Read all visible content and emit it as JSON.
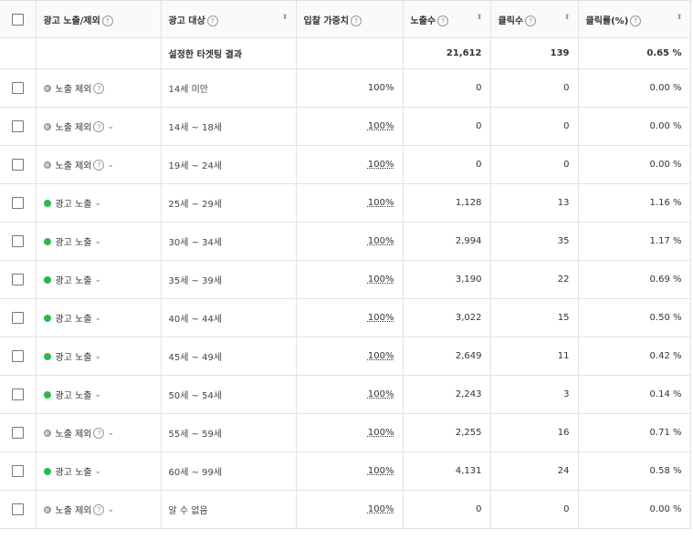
{
  "headers": {
    "status": "광고 노출/제외",
    "target": "광고 대상",
    "bid": "입찰 가중치",
    "impressions": "노출수",
    "clicks": "클릭수",
    "ctr": "클릭률(%)"
  },
  "summary": {
    "label": "설정한 타겟팅 결과",
    "impressions": "21,612",
    "clicks": "139",
    "ctr": "0.65 %"
  },
  "rows": [
    {
      "status": "노출 제외",
      "active": false,
      "help": true,
      "chevron": false,
      "target": "14세 미만",
      "bid": "100%",
      "bid_link": false,
      "impressions": "0",
      "clicks": "0",
      "ctr": "0.00 %"
    },
    {
      "status": "노출 제외",
      "active": false,
      "help": true,
      "chevron": true,
      "target": "14세 ~ 18세",
      "bid": "100%",
      "bid_link": true,
      "impressions": "0",
      "clicks": "0",
      "ctr": "0.00 %"
    },
    {
      "status": "노출 제외",
      "active": false,
      "help": true,
      "chevron": true,
      "target": "19세 ~ 24세",
      "bid": "100%",
      "bid_link": true,
      "impressions": "0",
      "clicks": "0",
      "ctr": "0.00 %"
    },
    {
      "status": "광고 노출",
      "active": true,
      "help": false,
      "chevron": true,
      "target": "25세 ~ 29세",
      "bid": "100%",
      "bid_link": true,
      "impressions": "1,128",
      "clicks": "13",
      "ctr": "1.16 %"
    },
    {
      "status": "광고 노출",
      "active": true,
      "help": false,
      "chevron": true,
      "target": "30세 ~ 34세",
      "bid": "100%",
      "bid_link": true,
      "impressions": "2,994",
      "clicks": "35",
      "ctr": "1.17 %"
    },
    {
      "status": "광고 노출",
      "active": true,
      "help": false,
      "chevron": true,
      "target": "35세 ~ 39세",
      "bid": "100%",
      "bid_link": true,
      "impressions": "3,190",
      "clicks": "22",
      "ctr": "0.69 %"
    },
    {
      "status": "광고 노출",
      "active": true,
      "help": false,
      "chevron": true,
      "target": "40세 ~ 44세",
      "bid": "100%",
      "bid_link": true,
      "impressions": "3,022",
      "clicks": "15",
      "ctr": "0.50 %"
    },
    {
      "status": "광고 노출",
      "active": true,
      "help": false,
      "chevron": true,
      "target": "45세 ~ 49세",
      "bid": "100%",
      "bid_link": true,
      "impressions": "2,649",
      "clicks": "11",
      "ctr": "0.42 %"
    },
    {
      "status": "광고 노출",
      "active": true,
      "help": false,
      "chevron": true,
      "target": "50세 ~ 54세",
      "bid": "100%",
      "bid_link": true,
      "impressions": "2,243",
      "clicks": "3",
      "ctr": "0.14 %"
    },
    {
      "status": "노출 제외",
      "active": false,
      "help": true,
      "chevron": true,
      "target": "55세 ~ 59세",
      "bid": "100%",
      "bid_link": true,
      "impressions": "2,255",
      "clicks": "16",
      "ctr": "0.71 %"
    },
    {
      "status": "광고 노출",
      "active": true,
      "help": false,
      "chevron": true,
      "target": "60세 ~ 99세",
      "bid": "100%",
      "bid_link": true,
      "impressions": "4,131",
      "clicks": "24",
      "ctr": "0.58 %"
    },
    {
      "status": "노출 제외",
      "active": false,
      "help": true,
      "chevron": true,
      "target": "알 수 없음",
      "bid": "100%",
      "bid_link": true,
      "impressions": "0",
      "clicks": "0",
      "ctr": "0.00 %"
    }
  ],
  "icons": {
    "help": "?",
    "sort": "⬍",
    "chevron": "⌄"
  },
  "colors": {
    "active": "#2db84d",
    "inactive": "#9b9b9b"
  }
}
